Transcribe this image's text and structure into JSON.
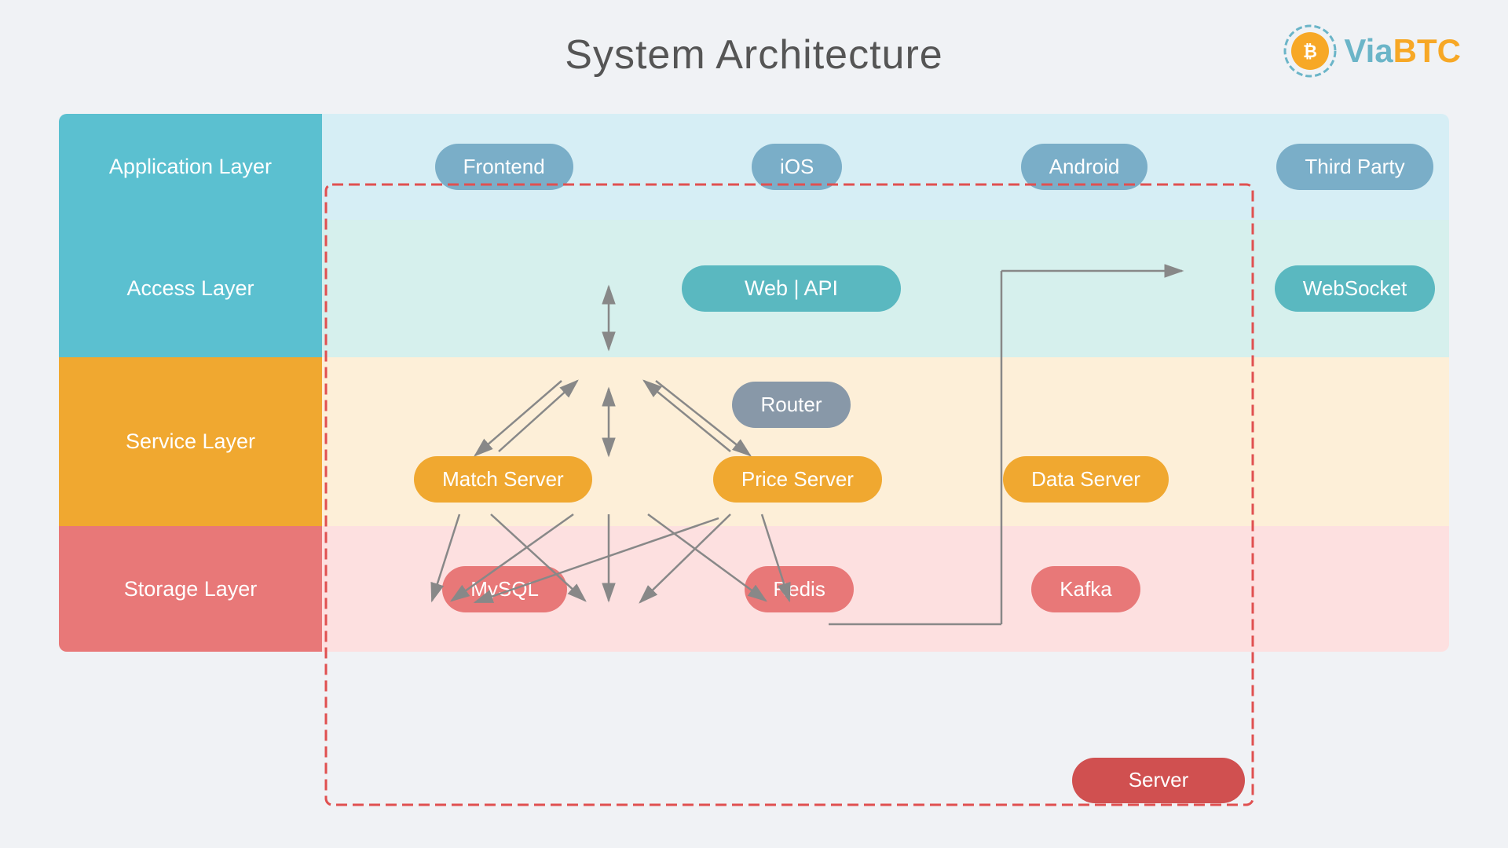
{
  "page": {
    "title": "System Architecture",
    "logo": {
      "via": "Via",
      "btc": "BTC"
    }
  },
  "layers": {
    "application": {
      "label": "Application Layer",
      "items": [
        "Frontend",
        "iOS",
        "Android",
        "Third Party"
      ]
    },
    "access": {
      "label": "Access Layer",
      "web_api": "Web  |  API",
      "websocket": "WebSocket"
    },
    "service": {
      "label": "Service Layer",
      "router": "Router",
      "servers": [
        "Match Server",
        "Price Server",
        "Data Server"
      ]
    },
    "storage": {
      "label": "Storage Layer",
      "items": [
        "MySQL",
        "Redis",
        "Kafka"
      ],
      "server": "Server"
    }
  }
}
